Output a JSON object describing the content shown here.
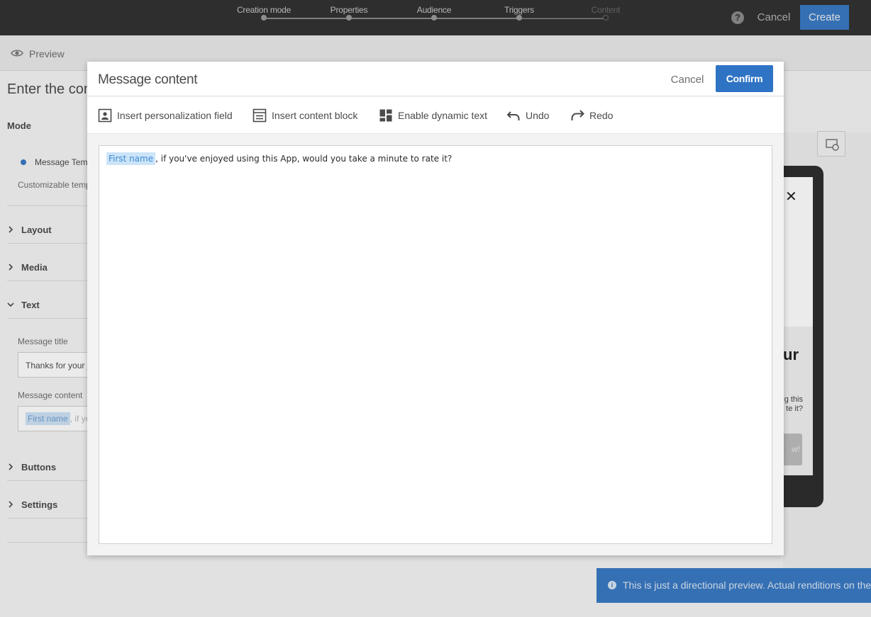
{
  "topbar": {
    "steps": [
      {
        "label": "Creation mode",
        "state": "done"
      },
      {
        "label": "Properties",
        "state": "done"
      },
      {
        "label": "Audience",
        "state": "done"
      },
      {
        "label": "Triggers",
        "state": "done"
      },
      {
        "label": "Content",
        "state": "todo"
      }
    ],
    "help_glyph": "?",
    "cancel_label": "Cancel",
    "create_label": "Create"
  },
  "background": {
    "preview_label": "Preview",
    "heading": "Enter the conte",
    "mode_label": "Mode",
    "radio_label": "Message Temp",
    "radio_desc": "Customizable temp",
    "sections": {
      "layout": "Layout",
      "media": "Media",
      "text": "Text",
      "buttons": "Buttons",
      "settings": "Settings"
    },
    "message_title_label": "Message title",
    "message_title_value": "Thanks for your j",
    "message_content_label": "Message content",
    "message_content_tag": "First name",
    "message_content_rest": ", if yo",
    "phone": {
      "close_glyph": "✕",
      "title_fragment": "ur",
      "body_fragment_1": "g this",
      "body_fragment_2": "te it?",
      "button_fragment": "w!"
    },
    "notice_icon": "i",
    "notice_text": "This is just a directional preview. Actual renditions on the d"
  },
  "modal": {
    "title": "Message content",
    "cancel_label": "Cancel",
    "confirm_label": "Confirm",
    "toolbar": {
      "insert_personalization": "Insert personalization field",
      "insert_block": "Insert content block",
      "dynamic_text": "Enable dynamic text",
      "undo": "Undo",
      "redo": "Redo"
    },
    "editor": {
      "tag": "First name",
      "text": ", if you've enjoyed using this App, would you take a minute to rate it?"
    }
  },
  "colors": {
    "topbar_bg": "#323232",
    "accent_blue": "#2f73c4",
    "tag_bg": "#cce4f8",
    "tag_text": "#3b8ad6"
  }
}
